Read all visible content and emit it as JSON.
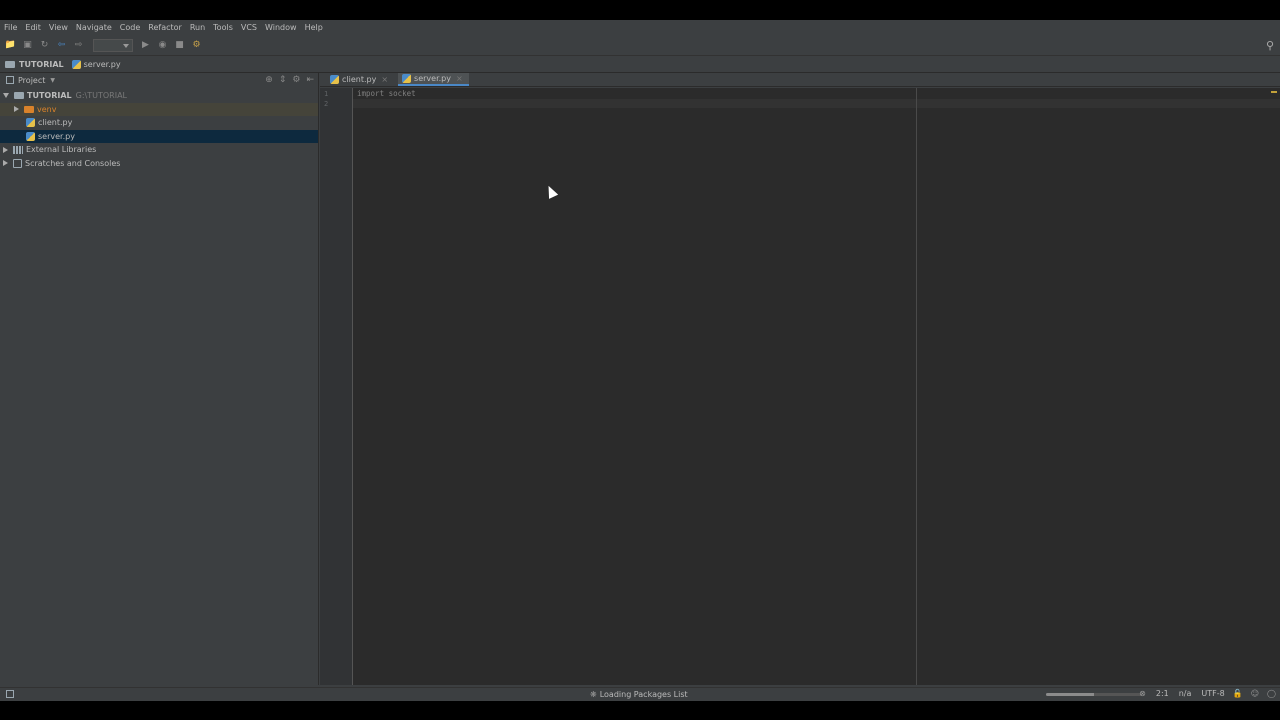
{
  "menu": [
    "File",
    "Edit",
    "View",
    "Navigate",
    "Code",
    "Refactor",
    "Run",
    "Tools",
    "VCS",
    "Window",
    "Help"
  ],
  "toolbar": {
    "icons": [
      "open-folder-icon",
      "save-icon",
      "sync-icon",
      "back-icon",
      "forward-icon",
      "run-icon",
      "debug-icon",
      "stop-icon",
      "vcs-icon",
      "search-icon"
    ]
  },
  "navbar": {
    "project": "TUTORIAL",
    "file": "server.py"
  },
  "project_panel": {
    "title": "Project",
    "tree": {
      "root": {
        "label": "TUTORIAL",
        "path": "G:\\TUTORIAL"
      },
      "venv": {
        "label": "venv"
      },
      "files": [
        "client.py",
        "server.py"
      ],
      "external": "External Libraries",
      "scratches": "Scratches and Consoles"
    }
  },
  "editor": {
    "tabs": [
      {
        "label": "client.py",
        "active": false
      },
      {
        "label": "server.py",
        "active": true
      }
    ],
    "line_numbers": [
      "1",
      "2"
    ],
    "code": [
      "import socket",
      ""
    ]
  },
  "statusbar": {
    "message": "Loading Packages List",
    "progress": 0.5,
    "position": "2:1",
    "line_separator": "n/a",
    "encoding": "UTF-8"
  },
  "colors": {
    "background": "#3c3f41",
    "editor": "#2b2b2b",
    "selection": "#0d293e",
    "accent": "#4a88c7"
  }
}
